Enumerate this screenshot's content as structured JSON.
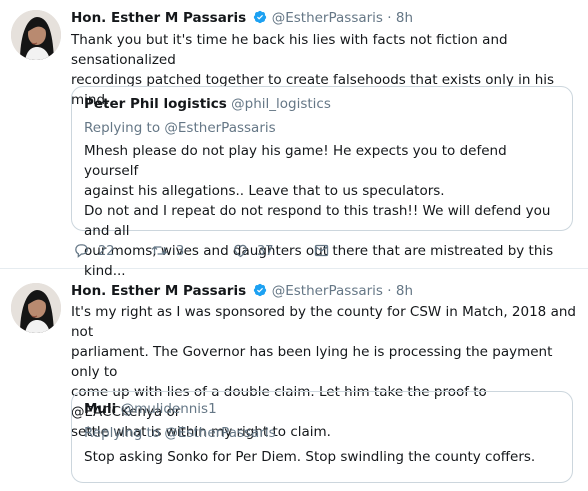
{
  "tweets": [
    {
      "fullname": "Hon. Esther M Passaris",
      "handle": "@EstherPassaris",
      "sep": "·",
      "time": "8h",
      "lines": [
        "Thank you but it's time he back his lies with facts not fiction and sensationalized",
        "recordings  patched together to create falsehoods that exists only in his mind."
      ],
      "quote": {
        "name": "Peter Phil logistics",
        "handle": "@phil_logistics",
        "replying": "Replying to @EstherPassaris",
        "lines": [
          "Mhesh please do not play his game! He expects you to defend yourself",
          "against his allegations.. Leave that to us speculators.",
          "Do not and I repeat do not respond to this trash!! We will defend you and all",
          "our moms, wives and daughters out there that are mistreated by this kind..."
        ]
      },
      "actions": {
        "replies": "22",
        "retweets": "3",
        "likes": "37"
      }
    },
    {
      "fullname": "Hon. Esther M Passaris",
      "handle": "@EstherPassaris",
      "sep": "·",
      "time": "8h",
      "lines": [
        "It's my right as I was sponsored by the county for CSW in Match, 2018 and not",
        "parliament. The Governor has been lying he is processing the payment only to",
        "come up with lies of a double claim. Let him take the proof to @EACCKenya or",
        "settle what is within my right to claim."
      ],
      "quote": {
        "name": "Muli",
        "handle": "@mulidennis1",
        "replying": "Replying to @EstherPassaris",
        "lines": [
          "Stop asking Sonko for Per Diem. Stop swindling the county coffers."
        ]
      }
    }
  ],
  "colors": {
    "verified": "#1da1f2",
    "meta": "#657786",
    "border": "#e6ecf0"
  },
  "icons": [
    "verified-badge-icon",
    "reply-icon",
    "retweet-icon",
    "like-icon",
    "message-icon"
  ]
}
